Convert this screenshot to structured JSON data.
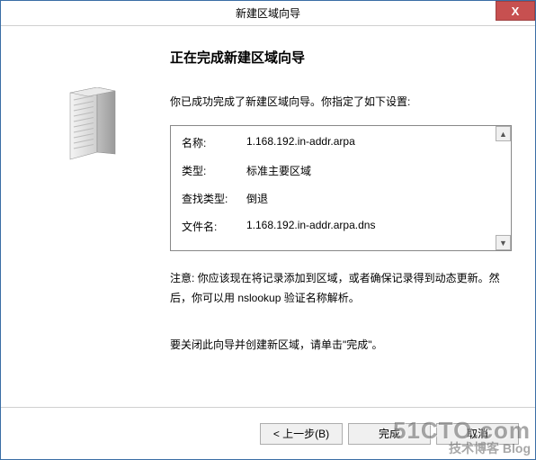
{
  "title": "新建区域向导",
  "close_label": "X",
  "heading": "正在完成新建区域向导",
  "summary_intro": "你已成功完成了新建区域向导。你指定了如下设置:",
  "settings": {
    "name_label": "名称:",
    "name_value": "1.168.192.in-addr.arpa",
    "type_label": "类型:",
    "type_value": "标准主要区域",
    "lookup_label": "查找类型:",
    "lookup_value": "倒退",
    "file_label": "文件名:",
    "file_value": "1.168.192.in-addr.arpa.dns"
  },
  "note": "注意: 你应该现在将记录添加到区域，或者确保记录得到动态更新。然后，你可以用 nslookup 验证名称解析。",
  "closing": "要关闭此向导并创建新区域，请单击\"完成\"。",
  "buttons": {
    "back": "< 上一步(B)",
    "finish": "完成",
    "cancel": "取消"
  },
  "scroll_up": "▲",
  "scroll_down": "▼",
  "watermark": {
    "line1": "51CTO.com",
    "line2": "技术博客 Blog"
  }
}
